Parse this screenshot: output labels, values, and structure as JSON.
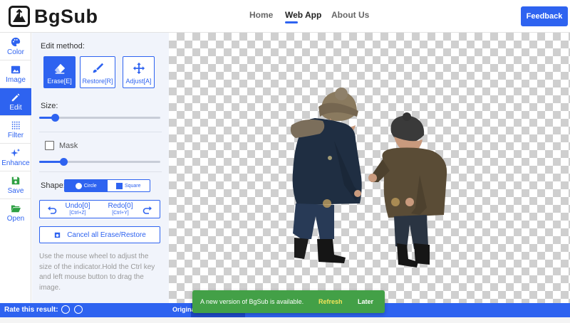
{
  "header": {
    "brand": "BgSub",
    "nav": [
      {
        "label": "Home",
        "active": false
      },
      {
        "label": "Web App",
        "active": true
      },
      {
        "label": "About Us",
        "active": false
      }
    ],
    "feedback_label": "Feedback"
  },
  "toolbar": {
    "items": [
      {
        "label": "Color",
        "icon": "palette-icon"
      },
      {
        "label": "Image",
        "icon": "image-icon"
      },
      {
        "label": "Edit",
        "icon": "pencil-icon",
        "active": true
      },
      {
        "label": "Filter",
        "icon": "dots-grid-icon"
      },
      {
        "label": "Enhance",
        "icon": "sparkle-icon"
      },
      {
        "label": "Save",
        "icon": "save-icon"
      },
      {
        "label": "Open",
        "icon": "folder-open-icon"
      }
    ]
  },
  "panel": {
    "edit_method_label": "Edit method:",
    "methods": [
      {
        "label": "Erase[E]",
        "icon": "eraser-icon",
        "active": true
      },
      {
        "label": "Restore[R]",
        "icon": "brush-icon"
      },
      {
        "label": "Adjust[A]",
        "icon": "move-icon"
      }
    ],
    "size_label": "Size:",
    "size_value": 0.13,
    "mask_label": "Mask",
    "mask_checked": false,
    "mask_value": 0.2,
    "shape_label": "Shape:",
    "shape_options": [
      {
        "label": "Circle",
        "active": true
      },
      {
        "label": "Square",
        "active": false
      }
    ],
    "undo_label": "Undo[0]",
    "undo_shortcut": "[Ctrl+Z]",
    "redo_label": "Redo[0]",
    "redo_shortcut": "[Ctrl+Y]",
    "cancel_label": "Cancel all Erase/Restore",
    "help_text": "Use the mouse wheel to adjust the size of the indicator.Hold the Ctrl key and left mouse button to drag the image."
  },
  "bottom_bar": {
    "rate_label": "Rate this result:",
    "original_label": "Origina"
  },
  "toast": {
    "message": "A new version of BgSub is available.",
    "refresh_label": "Refresh",
    "later_label": "Later"
  },
  "colors": {
    "accent": "#2e63f0",
    "toast": "#43a047",
    "refresh_text": "#f4e55a"
  }
}
